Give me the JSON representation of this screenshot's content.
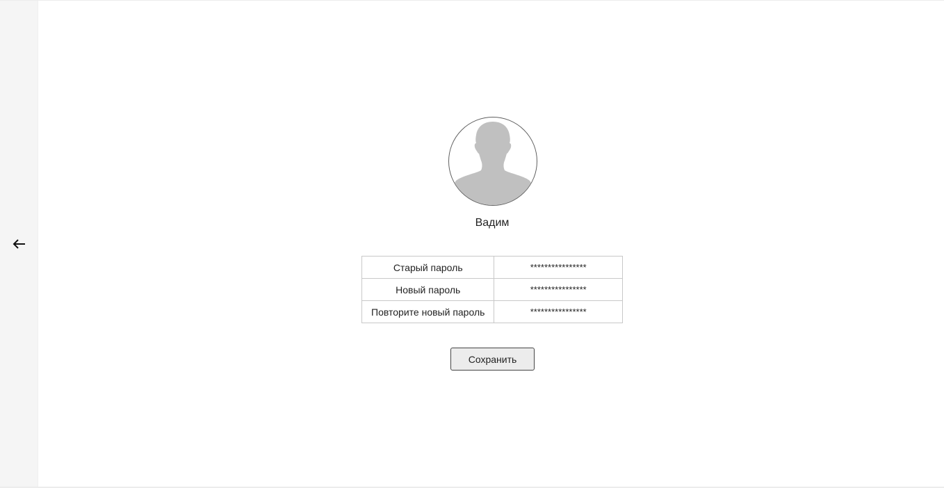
{
  "sidebar": {
    "back_icon": "arrow-left-icon",
    "back_glyph": "←"
  },
  "profile": {
    "avatar_icon": "user-silhouette-icon",
    "name": "Вадим"
  },
  "password_form": {
    "rows": [
      {
        "label": "Старый пароль",
        "value": "****************"
      },
      {
        "label": "Новый пароль",
        "value": "****************"
      },
      {
        "label": "Повторите новый пароль",
        "value": "****************"
      }
    ],
    "save_label": "Сохранить"
  },
  "colors": {
    "sidebar_bg": "#f5f5f5",
    "avatar_fill": "#c0c0c0",
    "table_border": "#c8c8c8",
    "button_bg": "#ececec"
  }
}
